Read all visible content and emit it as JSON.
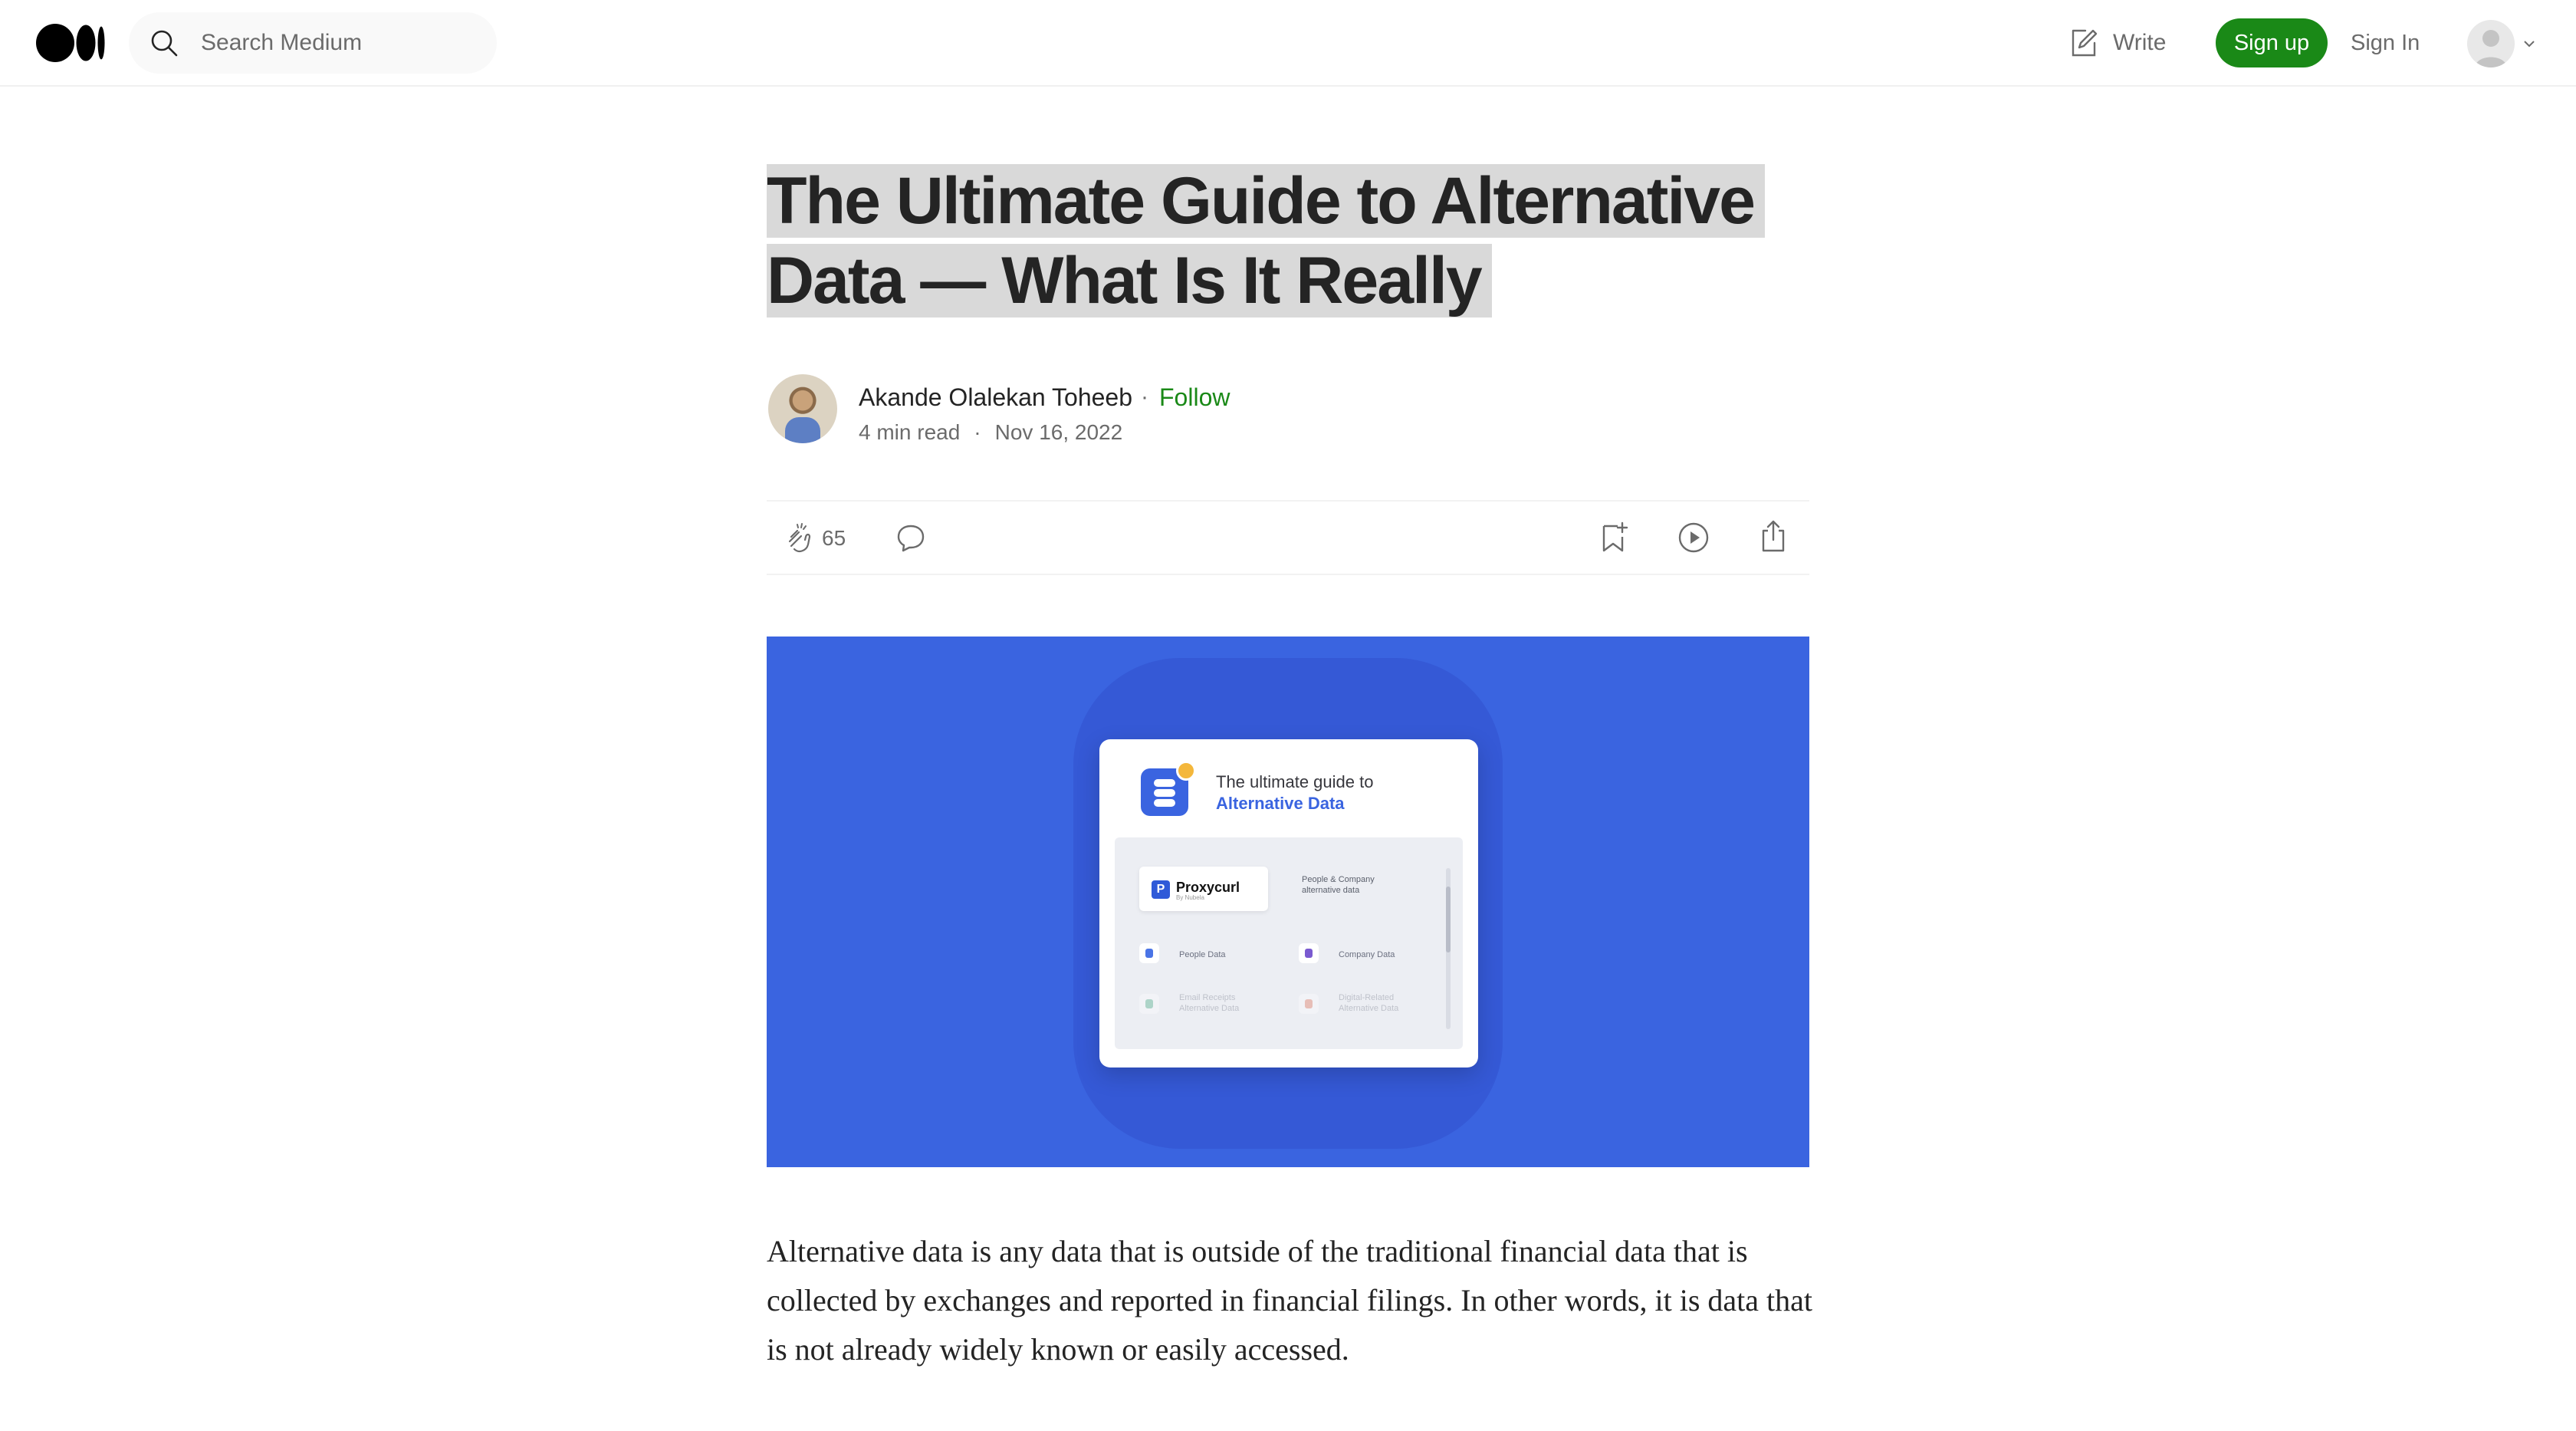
{
  "nav": {
    "search_placeholder": "Search Medium",
    "write_label": "Write",
    "signup_label": "Sign up",
    "signin_label": "Sign In"
  },
  "article": {
    "title": "The Ultimate Guide to Alternative Data — What Is It Really",
    "author": "Akande Olalekan Toheeb",
    "follow_label": "Follow",
    "read_time": "4 min read",
    "date": "Nov 16, 2022",
    "clap_count": "65",
    "paragraph": "Alternative data is any data that is outside of the traditional financial data that is collected by exchanges and reported in financial filings. In other words, it is data that is not already widely known or easily accessed."
  },
  "hero_card": {
    "line1": "The ultimate guide to",
    "line2": "Alternative Data",
    "brand": "Proxycurl",
    "brand_sub": "By Nubela",
    "tagline": "People & Company alternative data",
    "categories": [
      {
        "label": "People Data"
      },
      {
        "label": "Company Data"
      },
      {
        "label": "Email Receipts Alternative Data"
      },
      {
        "label": "Digital-Related Alternative Data"
      }
    ]
  },
  "colors": {
    "brand_green": "#1a8917",
    "hero_blue": "#3a64e0",
    "title_highlight": "#d9d9d9"
  },
  "icons": [
    "medium-logo-icon",
    "search-icon",
    "write-icon",
    "avatar-icon",
    "chevron-down-icon",
    "clap-icon",
    "response-icon",
    "bookmark-icon",
    "play-icon",
    "share-icon"
  ]
}
